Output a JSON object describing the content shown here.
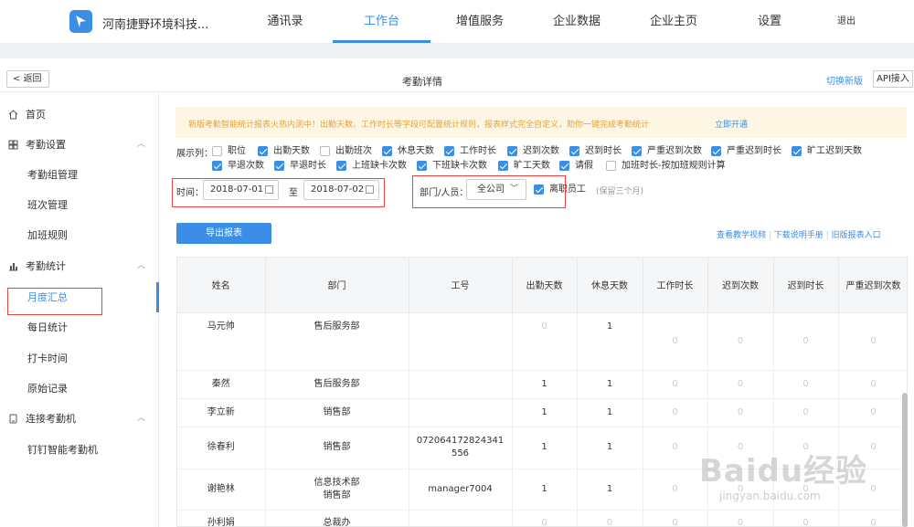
{
  "header": {
    "company": "河南捷野环境科技...",
    "nav": [
      "通讯录",
      "工作台",
      "增值服务",
      "企业数据",
      "企业主页",
      "设置",
      "退出"
    ],
    "active_nav": "工作台"
  },
  "subheader": {
    "back": "返回",
    "title": "考勤详情",
    "switch_new": "切换新版",
    "api": "API接入"
  },
  "sidebar": {
    "home": "首页",
    "settings": "考勤设置",
    "group_manage": "考勤组管理",
    "shift_manage": "班次管理",
    "overtime_rule": "加班规则",
    "stats": "考勤统计",
    "monthly": "月度汇总",
    "daily": "每日统计",
    "punch_time": "打卡时间",
    "raw_records": "原始记录",
    "connect": "连接考勤机",
    "dingtalk": "钉钉智能考勤机"
  },
  "banner": {
    "text": "新版考勤智能统计报表火热内测中！出勤天数、工作时长等字段可配置统计规则，报表样式完全自定义，助你一键完成考勤统计",
    "link": "立即开通"
  },
  "columns": {
    "label": "展示列：",
    "items": [
      {
        "label": "职位",
        "checked": false
      },
      {
        "label": "出勤天数",
        "checked": true
      },
      {
        "label": "出勤班次",
        "checked": false
      },
      {
        "label": "休息天数",
        "checked": true
      },
      {
        "label": "工作时长",
        "checked": true
      },
      {
        "label": "迟到次数",
        "checked": true
      },
      {
        "label": "迟到时长",
        "checked": true
      },
      {
        "label": "严重迟到次数",
        "checked": true
      },
      {
        "label": "严重迟到时长",
        "checked": true
      },
      {
        "label": "旷工迟到天数",
        "checked": true
      },
      {
        "label": "早退次数",
        "checked": true
      },
      {
        "label": "早退时长",
        "checked": true
      },
      {
        "label": "上班缺卡次数",
        "checked": true
      },
      {
        "label": "下班缺卡次数",
        "checked": true
      },
      {
        "label": "旷工天数",
        "checked": true
      },
      {
        "label": "请假",
        "checked": true
      },
      {
        "label": "加班时长-按加班规则计算",
        "checked": false
      }
    ]
  },
  "filters": {
    "time_label": "时间：",
    "start": "2018-07-01",
    "to": "至",
    "end": "2018-07-02",
    "dept_label": "部门/人员：",
    "dept_value": "全公司",
    "resigned_label": "离职员工",
    "resigned_checked": true,
    "keep_note": "(保留三个月)"
  },
  "actions": {
    "export": "导出报表",
    "video": "查看教学视频",
    "manual": "下载说明手册",
    "old": "旧版报表入口"
  },
  "table": {
    "headers": [
      "姓名",
      "部门",
      "工号",
      "出勤天数",
      "休息天数",
      "工作时长",
      "迟到次数",
      "迟到时长",
      "严重迟到次数"
    ],
    "rows": [
      {
        "name": "马元帅",
        "dept": "售后服务部",
        "id": "",
        "vals": [
          "0",
          "1",
          "0",
          "0",
          "0",
          "0"
        ]
      },
      {
        "name": "秦然",
        "dept": "售后服务部",
        "id": "",
        "vals": [
          "1",
          "1",
          "0",
          "0",
          "0",
          "0"
        ]
      },
      {
        "name": "李立新",
        "dept": "销售部",
        "id": "",
        "vals": [
          "1",
          "1",
          "0",
          "0",
          "0",
          "0"
        ]
      },
      {
        "name": "徐春利",
        "dept": "销售部",
        "id": "072064172824341556",
        "vals": [
          "1",
          "1",
          "0",
          "0",
          "0",
          "0"
        ]
      },
      {
        "name": "谢艳林",
        "dept": "信息技术部\n销售部",
        "id": "manager7004",
        "vals": [
          "1",
          "1",
          "0",
          "0",
          "0",
          "0"
        ]
      },
      {
        "name": "孙利娟",
        "dept": "总裁办",
        "id": "",
        "vals": [
          "0",
          "0",
          "0",
          "0",
          "0",
          "0"
        ]
      }
    ]
  },
  "watermark": {
    "brand": "Baidu经验",
    "url": "jingyan.baidu.com"
  }
}
